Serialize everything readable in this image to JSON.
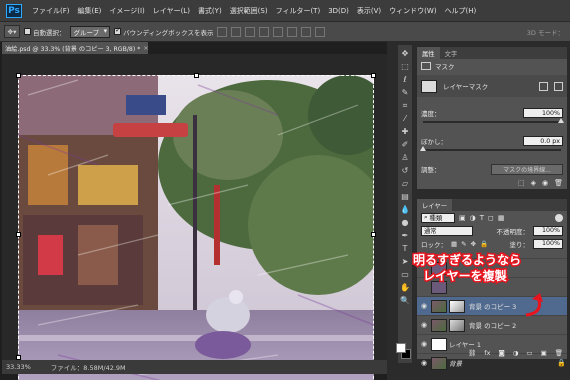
{
  "app": {
    "logo": "Ps"
  },
  "menu": [
    "ファイル(F)",
    "編集(E)",
    "イメージ(I)",
    "レイヤー(L)",
    "書式(Y)",
    "選択範囲(S)",
    "フィルター(T)",
    "3D(D)",
    "表示(V)",
    "ウィンドウ(W)",
    "ヘルプ(H)"
  ],
  "options": {
    "auto_select_label": "自動選択：",
    "group_value": "グループ",
    "transform_label": "バウンディングボックスを表示",
    "mode_3d": "3D モード："
  },
  "document": {
    "tab_title": "油絵.psd @ 33.3% (背景 のコピー 3, RGB/8) *",
    "close": "×",
    "zoom": "33.33%",
    "file_info": "ファイル：8.58M/42.9M"
  },
  "properties": {
    "tabs": [
      "属性",
      "文字"
    ],
    "section": "マスク",
    "mask_type": "レイヤーマスク",
    "density_label": "濃度：",
    "density_value": "100%",
    "density_level": 1.0,
    "feather_label": "ぼかし：",
    "feather_value": "0.0 px",
    "feather_level": 0.0,
    "refine_label": "調整：",
    "refine_button": "マスクの境界線..."
  },
  "layers": {
    "tab": "レイヤー",
    "filter_kind": "種類",
    "blend_mode": "通常",
    "opacity_label": "不透明度：",
    "opacity_value": "100%",
    "lock_label": "ロック：",
    "fill_label": "塗り：",
    "fill_value": "100%",
    "rows": [
      {
        "name": "背景 のコピー 3",
        "selected": true,
        "has_mask": true
      },
      {
        "name": "背景 のコピー 2",
        "selected": false,
        "has_mask": true
      },
      {
        "name": "レイヤー 1",
        "selected": false,
        "has_mask": false
      },
      {
        "name": "背景",
        "selected": false,
        "has_mask": false,
        "locked": true
      }
    ]
  },
  "annotation": {
    "line1": "明るすぎるようなら",
    "line2": "レイヤーを複製"
  },
  "colors": {
    "accent": "#31a8ff",
    "selection": "#4f6a8e",
    "annotation_stroke": "#e8141e"
  }
}
